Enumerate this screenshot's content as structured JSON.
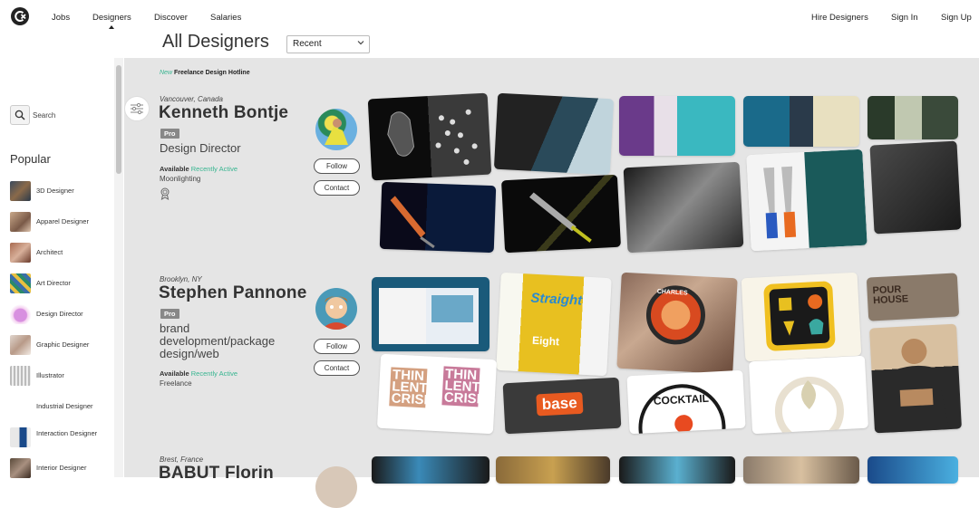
{
  "nav": {
    "jobs": "Jobs",
    "designers": "Designers",
    "discover": "Discover",
    "salaries": "Salaries",
    "hire": "Hire Designers",
    "signin": "Sign In",
    "signup": "Sign Up"
  },
  "page": {
    "title": "All Designers",
    "sort_value": "Recent"
  },
  "sidebar": {
    "search_label": "Search",
    "popular_title": "Popular",
    "categories": [
      "3D Designer",
      "Apparel Designer",
      "Architect",
      "Art Director",
      "Design Director",
      "Graphic Designer",
      "Illustrator",
      "Industrial Designer",
      "Interaction Designer",
      "Interior Designer"
    ]
  },
  "hotline": {
    "new": "New",
    "text": "Freelance Design Hotline"
  },
  "designers": [
    {
      "location": "Vancouver, Canada",
      "name": "Kenneth Bontje",
      "badge": "Pro",
      "title": "Design Director",
      "available": "Available",
      "recent": "Recently Active",
      "status": "Moonlighting",
      "follow": "Follow",
      "contact": "Contact"
    },
    {
      "location": "Brooklyn, NY",
      "name": "Stephen Pannone",
      "badge": "Pro",
      "title_lines": [
        "brand",
        "development/package",
        "design/web"
      ],
      "available": "Available",
      "recent": "Recently Active",
      "status": "Freelance",
      "follow": "Follow",
      "contact": "Contact"
    },
    {
      "location": "Brest, France",
      "name": "BABUT Florin"
    }
  ],
  "portfolio_text": {
    "straight": "Straight",
    "eight": "Eight",
    "thin_lentil_crisps": "THIN LENTIL CRISPS",
    "base": "base",
    "cocktail": "COCKTAIL",
    "charles": "CHARLES",
    "pour_house": "POUR HOUSE"
  },
  "colors": {
    "accent_green": "#37b590",
    "gallery_bg": "#e5e5e5"
  }
}
